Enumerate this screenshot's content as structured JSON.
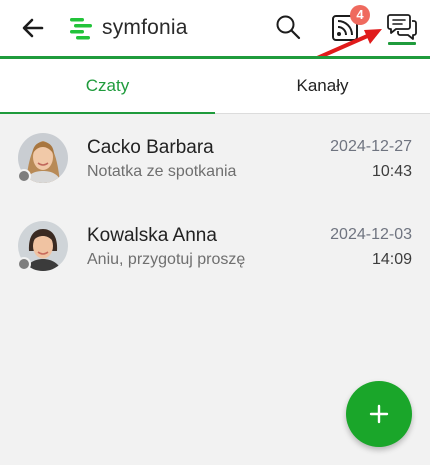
{
  "header": {
    "logo_text": "symfonia",
    "feed_badge_count": "4",
    "icons": [
      "back-arrow-icon",
      "search-icon",
      "feed-icon",
      "chat-bubbles-icon"
    ],
    "accent_color": "#1f9b3c"
  },
  "tabs": [
    {
      "label": "Czaty",
      "active": true
    },
    {
      "label": "Kanały",
      "active": false
    }
  ],
  "chats": [
    {
      "name": "Cacko Barbara",
      "preview": "Notatka ze spotkania",
      "date": "2024-12-27",
      "time": "10:43",
      "status": "offline"
    },
    {
      "name": "Kowalska Anna",
      "preview": "Aniu, przygotuj proszę",
      "date": "2024-12-03",
      "time": "14:09",
      "status": "offline"
    }
  ],
  "fab": {
    "icon": "plus-icon",
    "color": "#1aa62a"
  },
  "annotation": {
    "type": "red-arrow",
    "points_to": "chat-bubbles-icon"
  }
}
